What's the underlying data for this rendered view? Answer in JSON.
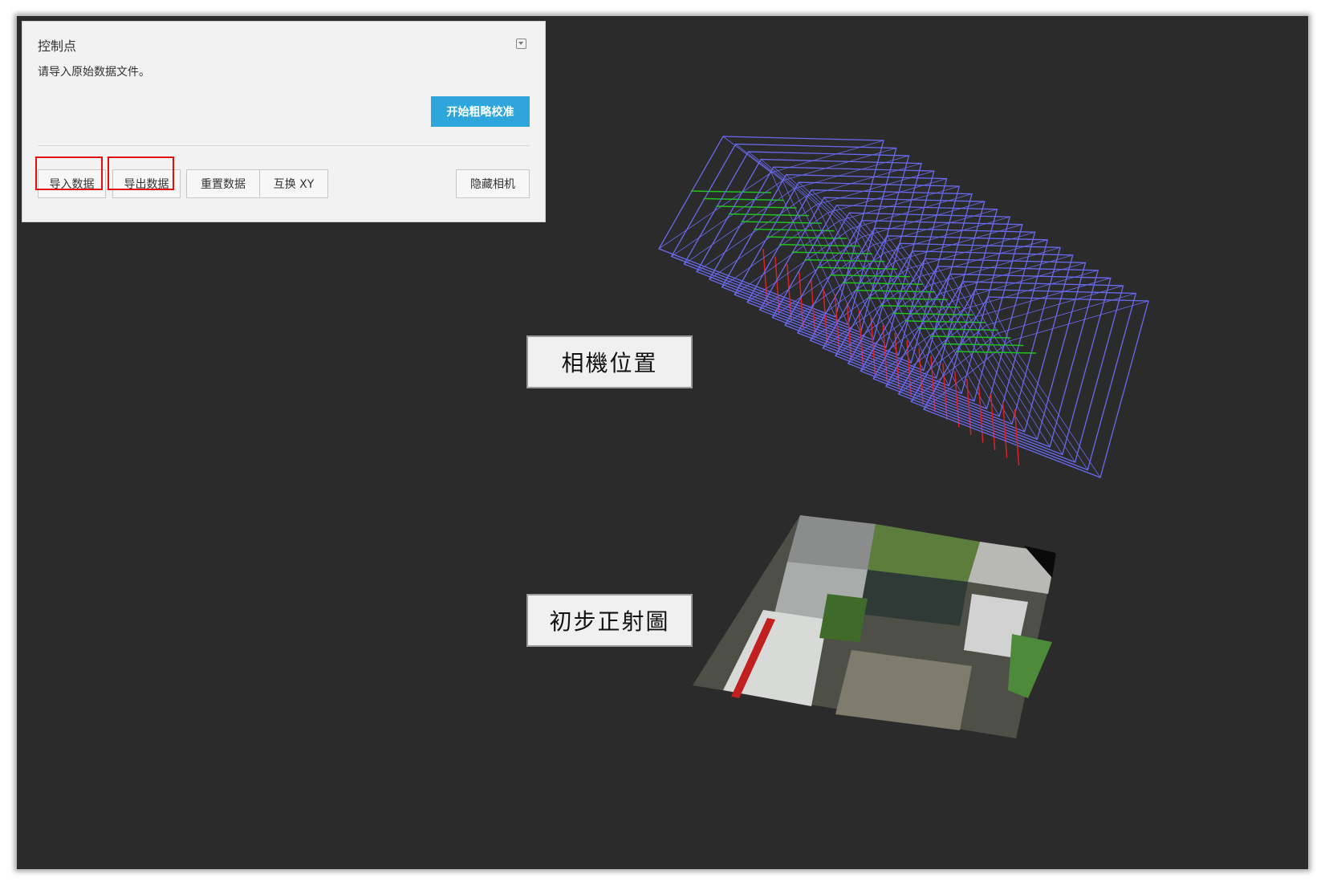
{
  "panel": {
    "title": "控制点",
    "message": "请导入原始数据文件。",
    "start_button": "开始粗略校准",
    "buttons": {
      "import": "导入数据",
      "export": "导出数据",
      "reset": "重置数据",
      "swap": "互换 XY",
      "hide_camera": "隐藏相机"
    }
  },
  "labels": {
    "camera_positions": "相機位置",
    "ortho_preview": "初步正射圖"
  },
  "colors": {
    "viewport_bg": "#2b2b2b",
    "primary": "#2ea6dc",
    "highlight": "#e01010",
    "frustum": "#6a6af0"
  }
}
